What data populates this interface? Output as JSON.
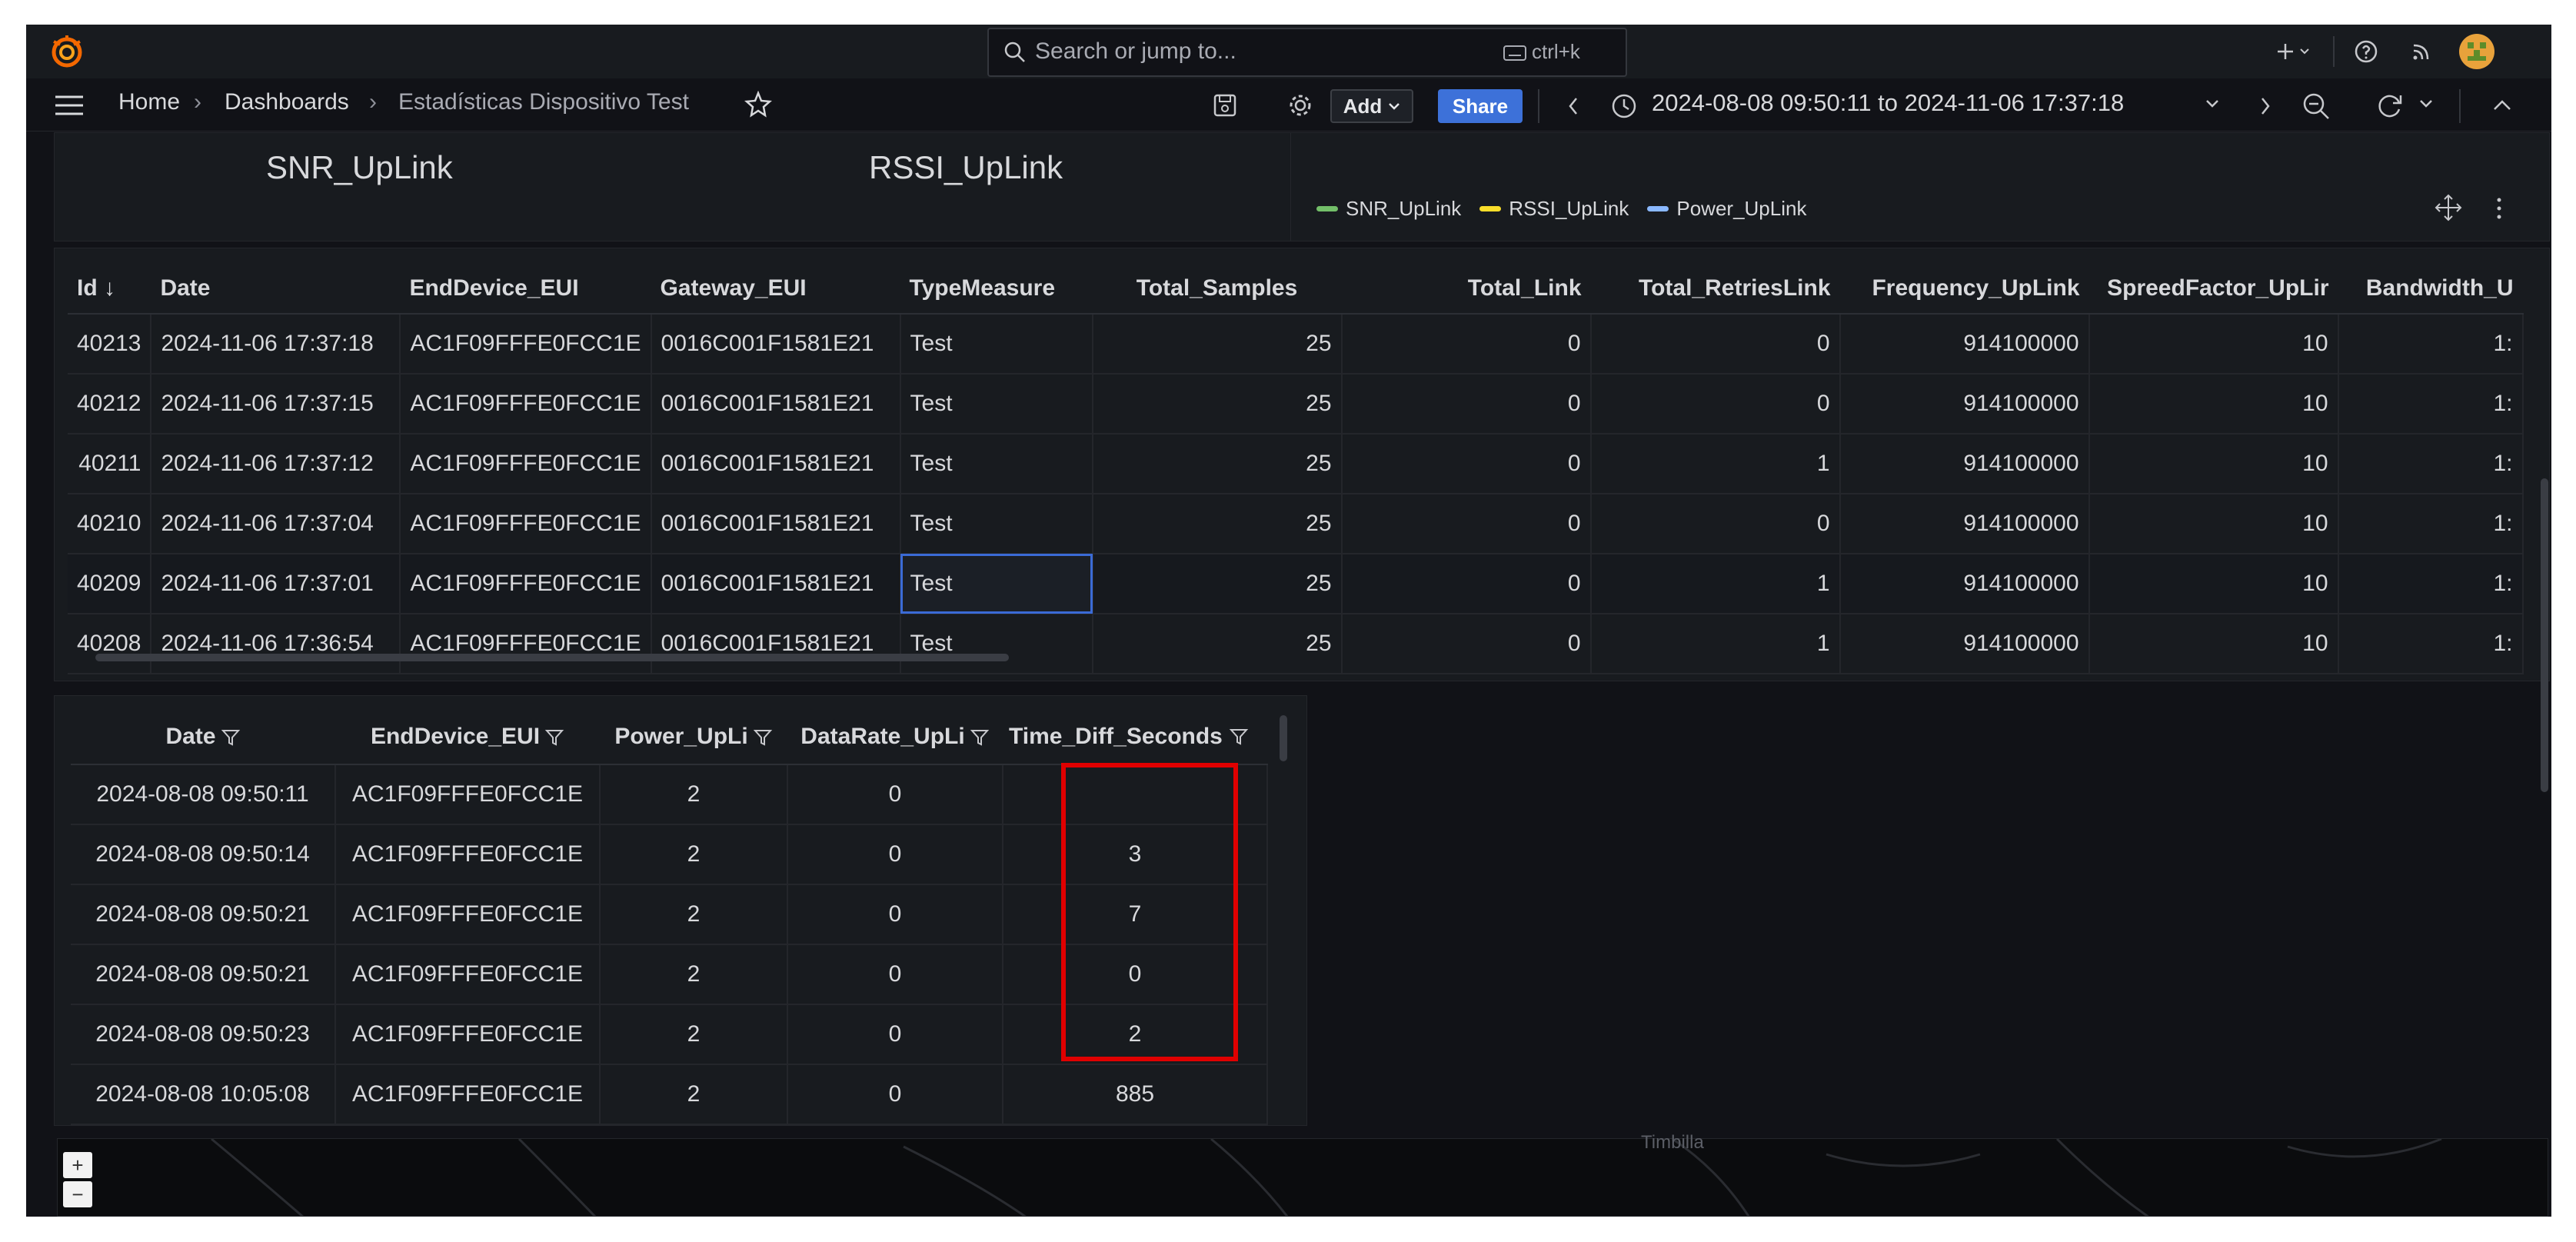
{
  "topbar": {
    "search_placeholder": "Search or jump to...",
    "shortcut": "ctrl+k"
  },
  "breadcrumb": [
    "Home",
    "Dashboards",
    "Estadísticas Dispositivo Test"
  ],
  "toolbar": {
    "add_label": "Add",
    "share_label": "Share",
    "time_range": "2024-08-08 09:50:11 to 2024-11-06 17:37:18"
  },
  "stats": {
    "snr_title": "SNR_UpLink",
    "rssi_title": "RSSI_UpLink"
  },
  "legend": [
    {
      "name": "SNR_UpLink",
      "color": "#73bf69"
    },
    {
      "name": "RSSI_UpLink",
      "color": "#fade2a"
    },
    {
      "name": "Power_UpLink",
      "color": "#8ab8ff"
    }
  ],
  "table1": {
    "columns": [
      "Id ↓",
      "Date",
      "EndDevice_EUI",
      "Gateway_EUI",
      "TypeMeasure",
      "Total_Samples",
      "Total_Link",
      "Total_RetriesLink",
      "Frequency_UpLink",
      "SpreedFactor_UpLir",
      "Bandwidth_U"
    ],
    "rows": [
      [
        "40213",
        "2024-11-06 17:37:18",
        "AC1F09FFFE0FCC1E",
        "0016C001F1581E21",
        "Test",
        "25",
        "0",
        "0",
        "914100000",
        "10",
        "1:"
      ],
      [
        "40212",
        "2024-11-06 17:37:15",
        "AC1F09FFFE0FCC1E",
        "0016C001F1581E21",
        "Test",
        "25",
        "0",
        "0",
        "914100000",
        "10",
        "1:"
      ],
      [
        "40211",
        "2024-11-06 17:37:12",
        "AC1F09FFFE0FCC1E",
        "0016C001F1581E21",
        "Test",
        "25",
        "0",
        "1",
        "914100000",
        "10",
        "1:"
      ],
      [
        "40210",
        "2024-11-06 17:37:04",
        "AC1F09FFFE0FCC1E",
        "0016C001F1581E21",
        "Test",
        "25",
        "0",
        "0",
        "914100000",
        "10",
        "1:"
      ],
      [
        "40209",
        "2024-11-06 17:37:01",
        "AC1F09FFFE0FCC1E",
        "0016C001F1581E21",
        "Test",
        "25",
        "0",
        "1",
        "914100000",
        "10",
        "1:"
      ],
      [
        "40208",
        "2024-11-06 17:36:54",
        "AC1F09FFFE0FCC1E",
        "0016C001F1581E21",
        "Test",
        "25",
        "0",
        "1",
        "914100000",
        "10",
        "1:"
      ]
    ]
  },
  "table2": {
    "columns": [
      "Date",
      "EndDevice_EUI",
      "Power_UpLi",
      "DataRate_UpLi",
      "Time_Diff_Seconds"
    ],
    "rows": [
      [
        "2024-08-08 09:50:11",
        "AC1F09FFFE0FCC1E",
        "2",
        "0",
        ""
      ],
      [
        "2024-08-08 09:50:14",
        "AC1F09FFFE0FCC1E",
        "2",
        "0",
        "3"
      ],
      [
        "2024-08-08 09:50:21",
        "AC1F09FFFE0FCC1E",
        "2",
        "0",
        "7"
      ],
      [
        "2024-08-08 09:50:21",
        "AC1F09FFFE0FCC1E",
        "2",
        "0",
        "0"
      ],
      [
        "2024-08-08 09:50:23",
        "AC1F09FFFE0FCC1E",
        "2",
        "0",
        "2"
      ],
      [
        "2024-08-08 10:05:08",
        "AC1F09FFFE0FCC1E",
        "2",
        "0",
        "885"
      ]
    ]
  },
  "map": {
    "zoom_in": "+",
    "zoom_out": "−",
    "place_label": "Timbilla"
  },
  "colors": {
    "accent": "#3d71d9",
    "highlight": "#e00000",
    "logo": "#f46800"
  }
}
